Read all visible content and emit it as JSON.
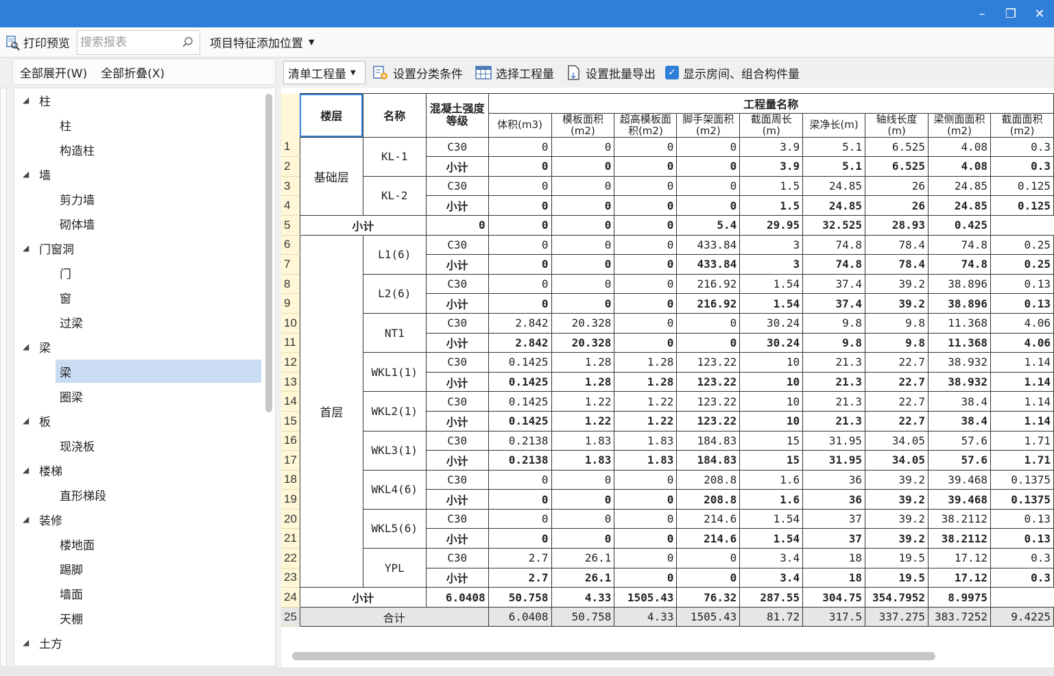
{
  "topbar": {
    "print_preview": "打印预览",
    "search_placeholder": "搜索报表",
    "feature_position": "项目特征添加位置"
  },
  "left": {
    "expand_all": "全部展开(W)",
    "collapse_all": "全部折叠(X)",
    "tree": [
      {
        "label": "柱",
        "children": [
          "柱",
          "构造柱"
        ]
      },
      {
        "label": "墙",
        "children": [
          "剪力墙",
          "砌体墙"
        ]
      },
      {
        "label": "门窗洞",
        "children": [
          "门",
          "窗",
          "过梁"
        ]
      },
      {
        "label": "梁",
        "children": [
          "梁",
          "圈梁"
        ]
      },
      {
        "label": "板",
        "children": [
          "现浇板"
        ]
      },
      {
        "label": "楼梯",
        "children": [
          "直形梯段"
        ]
      },
      {
        "label": "装修",
        "children": [
          "楼地面",
          "踢脚",
          "墙面",
          "天棚"
        ]
      },
      {
        "label": "土方",
        "children": []
      }
    ],
    "selected": "梁"
  },
  "toolbar": {
    "dropdown_value": "清单工程量",
    "set_classify": "设置分类条件",
    "select_quantity": "选择工程量",
    "set_batch_export": "设置批量导出",
    "show_rooms": "显示房间、组合构件量",
    "show_rooms_checked": true
  },
  "table": {
    "header_floor": "楼层",
    "header_name": "名称",
    "header_grade": "混凝土强度等级",
    "header_group": "工程量名称",
    "columns": [
      "体积(m3)",
      "模板面积(m2)",
      "超高模板面积(m2)",
      "脚手架面积(m2)",
      "截面周长(m)",
      "梁净长(m)",
      "轴线长度(m)",
      "梁侧面面积(m2)",
      "截面面积(m2)"
    ],
    "rows": [
      {
        "n": "1",
        "floor": "基础层",
        "name": "KL-1",
        "grade": "C30",
        "v": [
          "0",
          "0",
          "0",
          "0",
          "3.9",
          "5.1",
          "6.525",
          "4.08",
          "0.3"
        ]
      },
      {
        "n": "2",
        "grade": "小计",
        "v": [
          "0",
          "0",
          "0",
          "0",
          "3.9",
          "5.1",
          "6.525",
          "4.08",
          "0.3"
        ]
      },
      {
        "n": "3",
        "name": "KL-2",
        "grade": "C30",
        "v": [
          "0",
          "0",
          "0",
          "0",
          "1.5",
          "24.85",
          "26",
          "24.85",
          "0.125"
        ]
      },
      {
        "n": "4",
        "grade": "小计",
        "v": [
          "0",
          "0",
          "0",
          "0",
          "1.5",
          "24.85",
          "26",
          "24.85",
          "0.125"
        ]
      },
      {
        "n": "5",
        "floor_subtotal": "小计",
        "v": [
          "0",
          "0",
          "0",
          "0",
          "5.4",
          "29.95",
          "32.525",
          "28.93",
          "0.425"
        ]
      },
      {
        "n": "6",
        "floor": "首层",
        "name": "L1(6)",
        "grade": "C30",
        "v": [
          "0",
          "0",
          "0",
          "433.84",
          "3",
          "74.8",
          "78.4",
          "74.8",
          "0.25"
        ]
      },
      {
        "n": "7",
        "grade": "小计",
        "v": [
          "0",
          "0",
          "0",
          "433.84",
          "3",
          "74.8",
          "78.4",
          "74.8",
          "0.25"
        ]
      },
      {
        "n": "8",
        "name": "L2(6)",
        "grade": "C30",
        "v": [
          "0",
          "0",
          "0",
          "216.92",
          "1.54",
          "37.4",
          "39.2",
          "38.896",
          "0.13"
        ]
      },
      {
        "n": "9",
        "grade": "小计",
        "v": [
          "0",
          "0",
          "0",
          "216.92",
          "1.54",
          "37.4",
          "39.2",
          "38.896",
          "0.13"
        ]
      },
      {
        "n": "10",
        "name": "NT1",
        "grade": "C30",
        "v": [
          "2.842",
          "20.328",
          "0",
          "0",
          "30.24",
          "9.8",
          "9.8",
          "11.368",
          "4.06"
        ]
      },
      {
        "n": "11",
        "grade": "小计",
        "v": [
          "2.842",
          "20.328",
          "0",
          "0",
          "30.24",
          "9.8",
          "9.8",
          "11.368",
          "4.06"
        ]
      },
      {
        "n": "12",
        "name": "WKL1(1)",
        "grade": "C30",
        "v": [
          "0.1425",
          "1.28",
          "1.28",
          "123.22",
          "10",
          "21.3",
          "22.7",
          "38.932",
          "1.14"
        ]
      },
      {
        "n": "13",
        "grade": "小计",
        "v": [
          "0.1425",
          "1.28",
          "1.28",
          "123.22",
          "10",
          "21.3",
          "22.7",
          "38.932",
          "1.14"
        ]
      },
      {
        "n": "14",
        "name": "WKL2(1)",
        "grade": "C30",
        "v": [
          "0.1425",
          "1.22",
          "1.22",
          "123.22",
          "10",
          "21.3",
          "22.7",
          "38.4",
          "1.14"
        ]
      },
      {
        "n": "15",
        "grade": "小计",
        "v": [
          "0.1425",
          "1.22",
          "1.22",
          "123.22",
          "10",
          "21.3",
          "22.7",
          "38.4",
          "1.14"
        ]
      },
      {
        "n": "16",
        "name": "WKL3(1)",
        "grade": "C30",
        "v": [
          "0.2138",
          "1.83",
          "1.83",
          "184.83",
          "15",
          "31.95",
          "34.05",
          "57.6",
          "1.71"
        ]
      },
      {
        "n": "17",
        "grade": "小计",
        "v": [
          "0.2138",
          "1.83",
          "1.83",
          "184.83",
          "15",
          "31.95",
          "34.05",
          "57.6",
          "1.71"
        ]
      },
      {
        "n": "18",
        "name": "WKL4(6)",
        "grade": "C30",
        "v": [
          "0",
          "0",
          "0",
          "208.8",
          "1.6",
          "36",
          "39.2",
          "39.468",
          "0.1375"
        ]
      },
      {
        "n": "19",
        "grade": "小计",
        "v": [
          "0",
          "0",
          "0",
          "208.8",
          "1.6",
          "36",
          "39.2",
          "39.468",
          "0.1375"
        ]
      },
      {
        "n": "20",
        "name": "WKL5(6)",
        "grade": "C30",
        "v": [
          "0",
          "0",
          "0",
          "214.6",
          "1.54",
          "37",
          "39.2",
          "38.2112",
          "0.13"
        ]
      },
      {
        "n": "21",
        "grade": "小计",
        "v": [
          "0",
          "0",
          "0",
          "214.6",
          "1.54",
          "37",
          "39.2",
          "38.2112",
          "0.13"
        ]
      },
      {
        "n": "22",
        "name": "YPL",
        "grade": "C30",
        "v": [
          "2.7",
          "26.1",
          "0",
          "0",
          "3.4",
          "18",
          "19.5",
          "17.12",
          "0.3"
        ]
      },
      {
        "n": "23",
        "grade": "小计",
        "v": [
          "2.7",
          "26.1",
          "0",
          "0",
          "3.4",
          "18",
          "19.5",
          "17.12",
          "0.3"
        ]
      },
      {
        "n": "24",
        "floor_subtotal": "小计",
        "v": [
          "6.0408",
          "50.758",
          "4.33",
          "1505.43",
          "76.32",
          "287.55",
          "304.75",
          "354.7952",
          "8.9975"
        ]
      },
      {
        "n": "25",
        "total": "合计",
        "v": [
          "6.0408",
          "50.758",
          "4.33",
          "1505.43",
          "81.72",
          "317.5",
          "337.275",
          "383.7252",
          "9.4225"
        ]
      }
    ]
  }
}
